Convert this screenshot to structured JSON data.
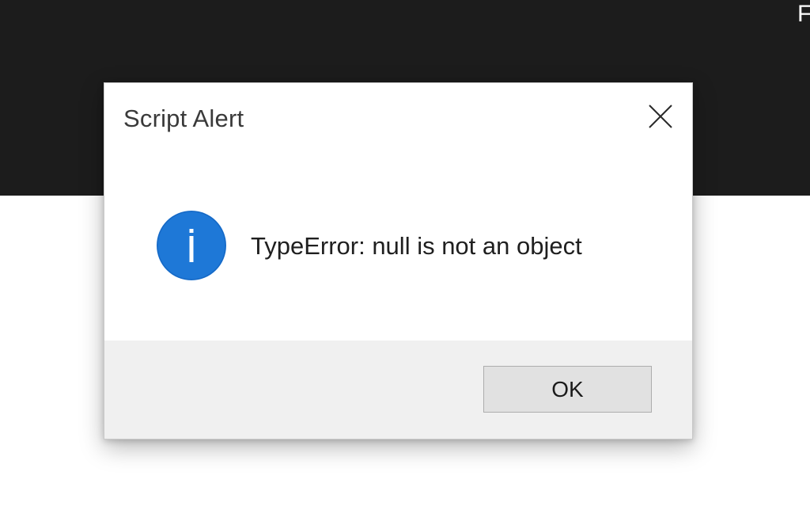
{
  "corner_text": "F",
  "dialog": {
    "title": "Script Alert",
    "message": "TypeError: null is not an object",
    "ok_label": "OK",
    "close_icon": "close-icon",
    "message_icon": "info-icon",
    "accent_color": "#1e78d7"
  }
}
